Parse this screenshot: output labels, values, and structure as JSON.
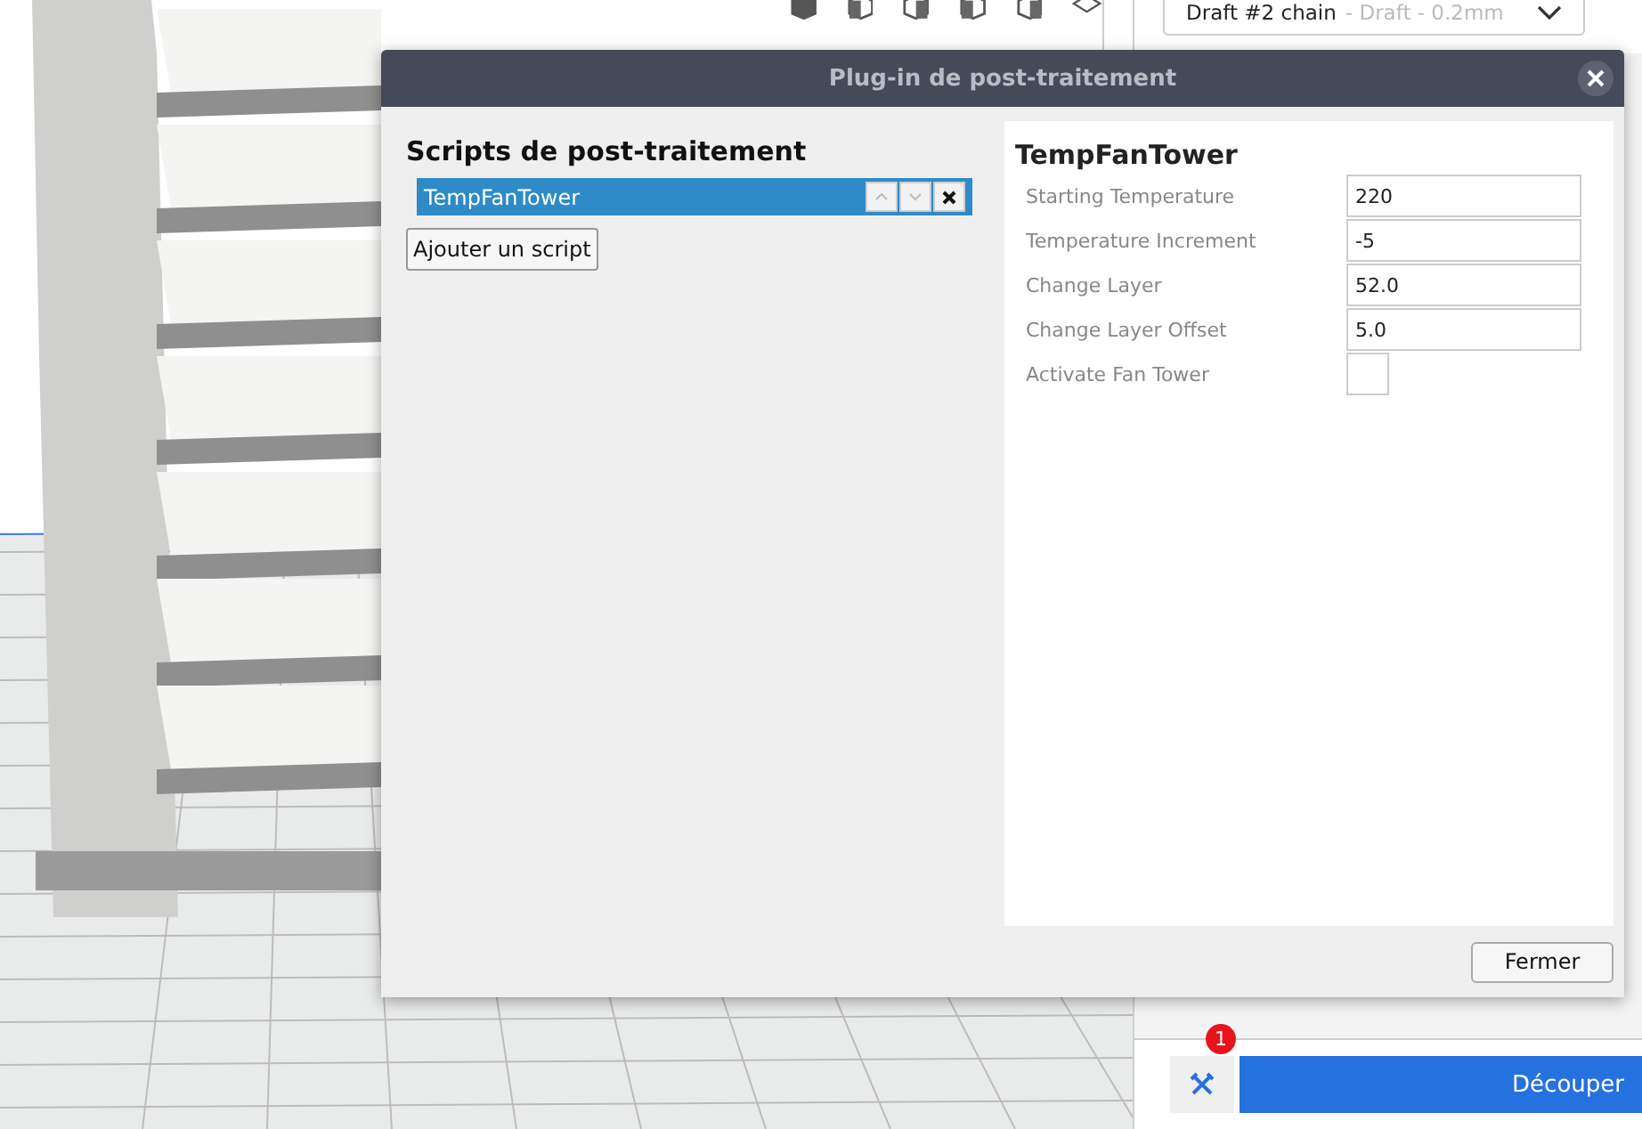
{
  "profile_dropdown": {
    "name": "Draft #2 chain",
    "detail": "- Draft - 0.2mm"
  },
  "dialog": {
    "title": "Plug-in de post-traitement",
    "scripts_heading": "Scripts de post-traitement",
    "scripts": [
      {
        "name": "TempFanTower",
        "selected": true
      }
    ],
    "add_button": "Ajouter un script",
    "settings_title": "TempFanTower",
    "settings": [
      {
        "kind": "text",
        "label": "Starting Temperature",
        "value": "220"
      },
      {
        "kind": "text",
        "label": "Temperature Increment",
        "value": "-5"
      },
      {
        "kind": "text",
        "label": "Change Layer",
        "value": "52.0"
      },
      {
        "kind": "text",
        "label": "Change Layer Offset",
        "value": "5.0"
      },
      {
        "kind": "checkbox",
        "label": "Activate Fan Tower",
        "checked": false
      }
    ],
    "close_button": "Fermer"
  },
  "slice_bar": {
    "badge": "1",
    "slice_button": "Découper"
  }
}
